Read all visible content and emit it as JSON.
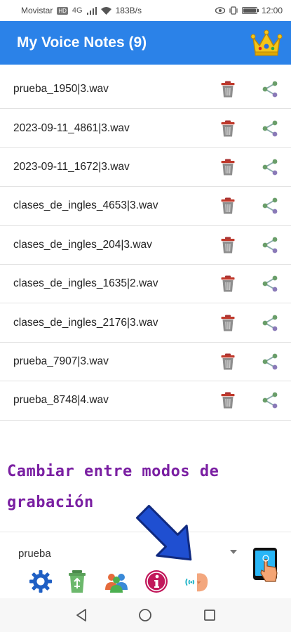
{
  "status_bar": {
    "carrier": "Movistar",
    "hd_badge": "HD",
    "network": "4G",
    "speed": "183B/s",
    "time": "12:00",
    "battery_level": 0.9
  },
  "app_bar": {
    "title": "My Voice Notes (9)",
    "premium_icon": "crown-icon"
  },
  "notes": [
    {
      "name": "prueba_1950|3.wav"
    },
    {
      "name": "2023-09-11_4861|3.wav"
    },
    {
      "name": "2023-09-11_1672|3.wav"
    },
    {
      "name": "clases_de_ingles_4653|3.wav"
    },
    {
      "name": "clases_de_ingles_204|3.wav"
    },
    {
      "name": "clases_de_ingles_1635|2.wav"
    },
    {
      "name": "clases_de_ingles_2176|3.wav"
    },
    {
      "name": "prueba_7907|3.wav"
    },
    {
      "name": "prueba_8748|4.wav"
    }
  ],
  "overlay": {
    "line1": "Cambiar entre modos de",
    "line2": "grabación"
  },
  "bottom_panel": {
    "selected_mode": "prueba",
    "tools": [
      "settings-gear-icon",
      "recycle-bin-icon",
      "contacts-icon",
      "info-icon",
      "voice-mode-icon"
    ]
  },
  "colors": {
    "app_bar": "#2b82e8",
    "overlay_text": "#7a1fa2",
    "arrow": "#1f4fd1"
  }
}
